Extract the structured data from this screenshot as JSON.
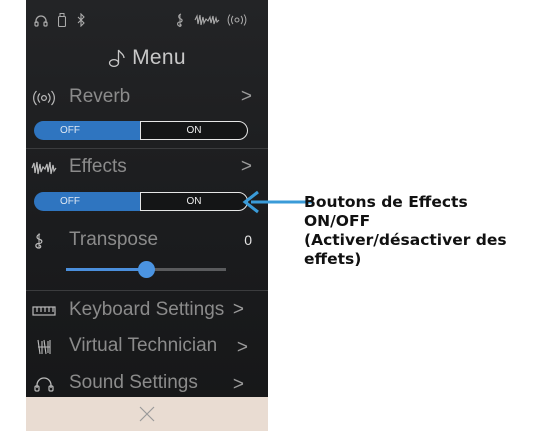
{
  "menu_title": "Menu",
  "items": {
    "reverb": {
      "label": "Reverb",
      "chevron": ">",
      "toggle": {
        "off_label": "OFF",
        "on_label": "ON"
      }
    },
    "effects": {
      "label": "Effects",
      "chevron": ">",
      "toggle": {
        "off_label": "OFF",
        "on_label": "ON"
      }
    },
    "transpose": {
      "label": "Transpose",
      "value": "0",
      "slider_position": 0.5
    },
    "keyboard_settings": {
      "label": "Keyboard Settings",
      "chevron": ">"
    },
    "virtual_technician": {
      "label": "Virtual Technician",
      "chevron": ">"
    },
    "sound_settings": {
      "label": "Sound Settings",
      "chevron": ">"
    }
  },
  "close_symbol": "×",
  "callout": {
    "line1": "Boutons de Effects",
    "line2": "ON/OFF",
    "line3": "(Activer/désactiver des",
    "line4": "effets)"
  },
  "colors": {
    "toggle_active": "#2f75c0",
    "slider_accent": "#4b94e2",
    "arrow": "#3a9bd8",
    "screen_bg": "#1c1d1f",
    "bottom_bar": "#e9dcd2"
  },
  "icons": [
    "headphones-icon",
    "usb-drive-icon",
    "bluetooth-icon",
    "metronome-icon",
    "effects-wave-icon",
    "reverb-icon",
    "music-note-icon",
    "treble-clef-icon",
    "keyboard-icon",
    "technician-icon",
    "close-icon"
  ]
}
